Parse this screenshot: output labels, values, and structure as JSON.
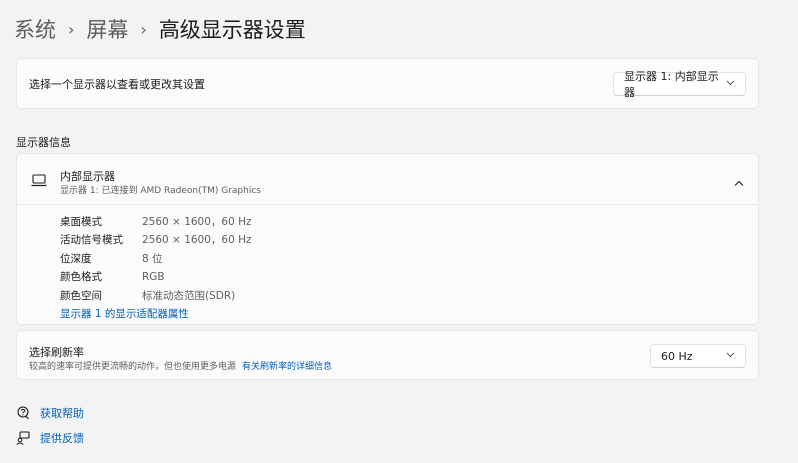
{
  "breadcrumb": {
    "items": [
      "系统",
      "屏幕"
    ],
    "current": "高级显示器设置",
    "separator": "›"
  },
  "display_select": {
    "label": "选择一个显示器以查看或更改其设置",
    "selected": "显示器 1: 内部显示器"
  },
  "section_title": "显示器信息",
  "display_info": {
    "name": "内部显示器",
    "subtitle": "显示器 1: 已连接到 AMD Radeon(TM) Graphics",
    "properties": [
      {
        "key": "桌面模式",
        "value": "2560 × 1600，60 Hz"
      },
      {
        "key": "活动信号模式",
        "value": "2560 × 1600，60 Hz"
      },
      {
        "key": "位深度",
        "value": "8 位"
      },
      {
        "key": "颜色格式",
        "value": "RGB"
      },
      {
        "key": "颜色空间",
        "value": "标准动态范围(SDR)"
      }
    ],
    "adapter_link": "显示器 1 的显示适配器属性"
  },
  "refresh_rate": {
    "title": "选择刷新率",
    "description": "较高的速率可提供更流畅的动作，但也使用更多电源",
    "link": "有关刷新率的详细信息",
    "selected": "60 Hz"
  },
  "footer": {
    "help": "获取帮助",
    "feedback": "提供反馈"
  },
  "colors": {
    "background": "#f3f3f3",
    "card": "#fbfbfb",
    "link": "#005fb8"
  }
}
